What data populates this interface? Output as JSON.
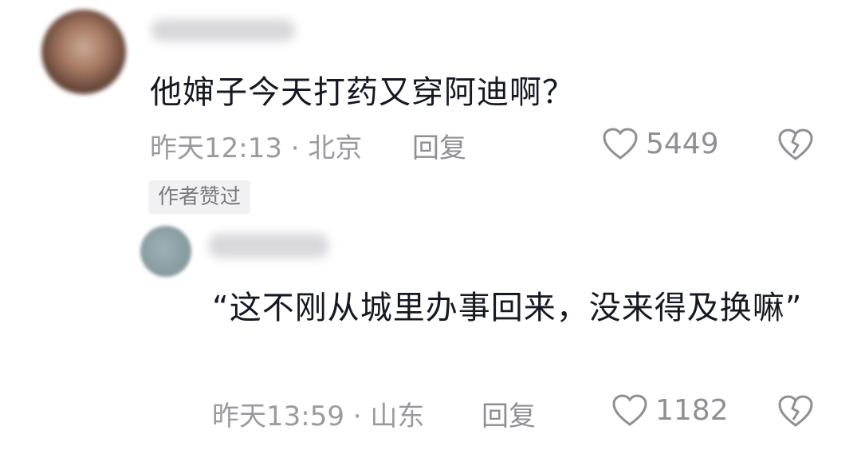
{
  "comment": {
    "text": "他婶子今天打药又穿阿迪啊？",
    "time_location": "昨天12:13 · 北京",
    "reply_label": "回复",
    "like_count": "5449",
    "badge": "作者赞过",
    "icons": {
      "like": "heart-outline-icon",
      "dislike": "broken-heart-icon"
    }
  },
  "reply": {
    "text": "“这不刚从城里办事回来，没来得及换嘛”",
    "time_location": "昨天13:59 · 山东",
    "reply_label": "回复",
    "like_count": "1182",
    "icons": {
      "like": "heart-outline-icon",
      "dislike": "broken-heart-icon"
    }
  },
  "colors": {
    "background": "#ffffff",
    "text_primary": "#161823",
    "text_secondary": "#9a9a9f",
    "badge_bg": "#f1f1f3"
  }
}
